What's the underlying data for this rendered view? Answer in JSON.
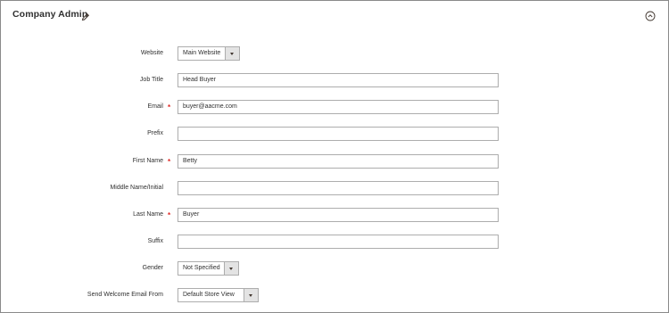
{
  "panel": {
    "title": "Company Admin"
  },
  "fields": {
    "website": {
      "label": "Website",
      "value": "Main Website"
    },
    "job_title": {
      "label": "Job Title",
      "value": "Head Buyer"
    },
    "email": {
      "label": "Email",
      "value": "buyer@aacme.com",
      "required_mark": "*"
    },
    "prefix": {
      "label": "Prefix",
      "value": ""
    },
    "first_name": {
      "label": "First Name",
      "value": "Betty",
      "required_mark": "*"
    },
    "middle_name": {
      "label": "Middle Name/Initial",
      "value": ""
    },
    "last_name": {
      "label": "Last Name",
      "value": "Buyer",
      "required_mark": "*"
    },
    "suffix": {
      "label": "Suffix",
      "value": ""
    },
    "gender": {
      "label": "Gender",
      "value": "Not Specified"
    },
    "send_welcome": {
      "label": "Send Welcome Email From",
      "value": "Default Store View"
    }
  },
  "colors": {
    "required": "#e02b27",
    "border": "#adadad",
    "text": "#303030"
  }
}
